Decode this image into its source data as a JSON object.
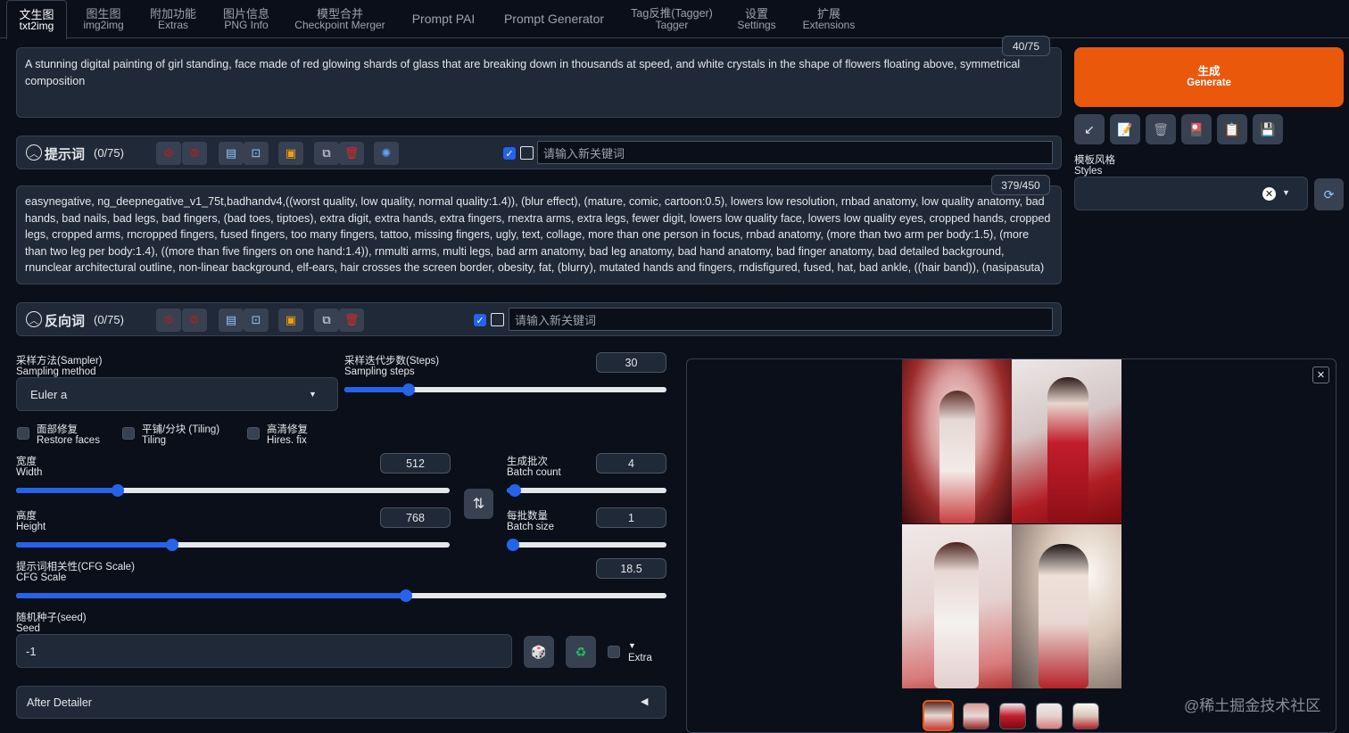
{
  "tabs": [
    {
      "zh": "文生图",
      "en": "txt2img",
      "active": true
    },
    {
      "zh": "图生图",
      "en": "img2img"
    },
    {
      "zh": "附加功能",
      "en": "Extras"
    },
    {
      "zh": "图片信息",
      "en": "PNG Info"
    },
    {
      "zh": "模型合并",
      "en": "Checkpoint Merger"
    },
    {
      "single": "Prompt PAI"
    },
    {
      "single": "Prompt Generator"
    },
    {
      "zh": "Tag反推(Tagger)",
      "en": "Tagger"
    },
    {
      "zh": "设置",
      "en": "Settings"
    },
    {
      "zh": "扩展",
      "en": "Extensions"
    }
  ],
  "prompt": {
    "counter": "40/75",
    "text": "A stunning digital painting of girl standing, face made of red glowing shards of glass that are breaking down in thousands at speed, and white crystals in the shape of flowers floating above, symmetrical composition"
  },
  "prompt_toolbar": {
    "title": "提示词",
    "count": "(0/75)",
    "keyword_placeholder": "请输入新关键词"
  },
  "negative": {
    "counter": "379/450",
    "text": "easynegative, ng_deepnegative_v1_75t,badhandv4,((worst quality, low quality, normal quality:1.4)), (blur effect), (mature, comic, cartoon:0.5), lowers low resolution, rnbad anatomy, low quality anatomy, bad hands, bad nails, bad legs, bad fingers, (bad toes, tiptoes), extra digit, extra hands, extra fingers, rnextra arms, extra legs, fewer digit, lowers low quality face, lowers low quality eyes, cropped hands, cropped legs, cropped arms, rncropped fingers, fused fingers, too many fingers, tattoo, missing fingers, ugly, text, collage, more than one person in focus, rnbad anatomy, (more than two arm per body:1.5), (more than two leg per body:1.4), ((more than five fingers on one hand:1.4)), rnmulti arms, multi legs, bad arm anatomy, bad leg anatomy, bad hand anatomy, bad finger anatomy, bad detailed background, rnunclear architectural outline, non-linear background, elf-ears, hair crosses the screen border, obesity, fat, (blurry), mutated hands and fingers, rndisfigured, fused, hat, bad ankle, ((hair band)), (nasipasuta)"
  },
  "negative_toolbar": {
    "title": "反向词",
    "count": "(0/75)",
    "keyword_placeholder": "请输入新关键词"
  },
  "generate": {
    "zh": "生成",
    "en": "Generate"
  },
  "styles": {
    "zh": "模板风格",
    "en": "Styles"
  },
  "sampler": {
    "zh": "采样方法(Sampler)",
    "en": "Sampling method",
    "value": "Euler a"
  },
  "steps": {
    "zh": "采样迭代步数(Steps)",
    "en": "Sampling steps",
    "value": "30",
    "fraction": 0.2
  },
  "options": {
    "restore": {
      "zh": "面部修复",
      "en": "Restore faces"
    },
    "tiling": {
      "zh": "平铺/分块 (Tiling)",
      "en": "Tiling"
    },
    "hires": {
      "zh": "高清修复",
      "en": "Hires. fix"
    }
  },
  "width": {
    "zh": "宽度",
    "en": "Width",
    "value": "512",
    "fraction": 0.235
  },
  "height": {
    "zh": "高度",
    "en": "Height",
    "value": "768",
    "fraction": 0.36
  },
  "batch_count": {
    "zh": "生成批次",
    "en": "Batch count",
    "value": "4",
    "fraction": 0.05
  },
  "batch_size": {
    "zh": "每批数量",
    "en": "Batch size",
    "value": "1",
    "fraction": 0.0
  },
  "cfg": {
    "zh": "提示词相关性(CFG Scale)",
    "en": "CFG Scale",
    "value": "18.5",
    "fraction": 0.6
  },
  "seed": {
    "zh": "随机种子(seed)",
    "en": "Seed",
    "value": "-1",
    "extra": "Extra"
  },
  "after_detailer": "After Detailer",
  "watermark": "@稀土掘金技术社区",
  "colors": {
    "accent": "#2563eb",
    "generate": "#ea580c",
    "bg": "#0b0f19",
    "panel": "#1f2937"
  }
}
